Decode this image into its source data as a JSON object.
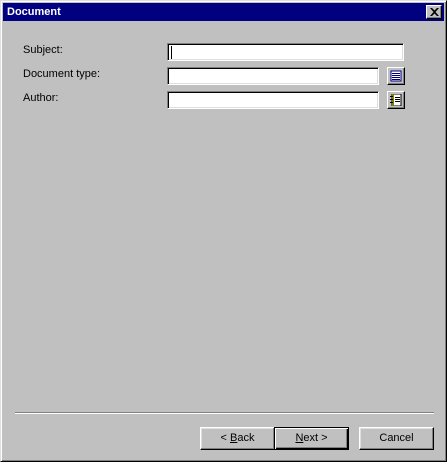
{
  "window": {
    "title": "Document"
  },
  "form": {
    "subject": {
      "label": "Subject:",
      "value": ""
    },
    "document_type": {
      "label": "Document type:",
      "value": ""
    },
    "author": {
      "label": "Author:",
      "value": ""
    }
  },
  "buttons": {
    "back": {
      "prefix": "< ",
      "mnemonic": "B",
      "rest": "ack"
    },
    "next": {
      "mnemonic": "N",
      "rest": "ext >"
    },
    "cancel": {
      "label": "Cancel"
    }
  },
  "icons": {
    "close": "close-icon",
    "document_type_lookup": "list-icon",
    "author_lookup": "address-book-icon"
  },
  "colors": {
    "title_bar": "#000080",
    "dialog_face": "#c0c0c0"
  }
}
